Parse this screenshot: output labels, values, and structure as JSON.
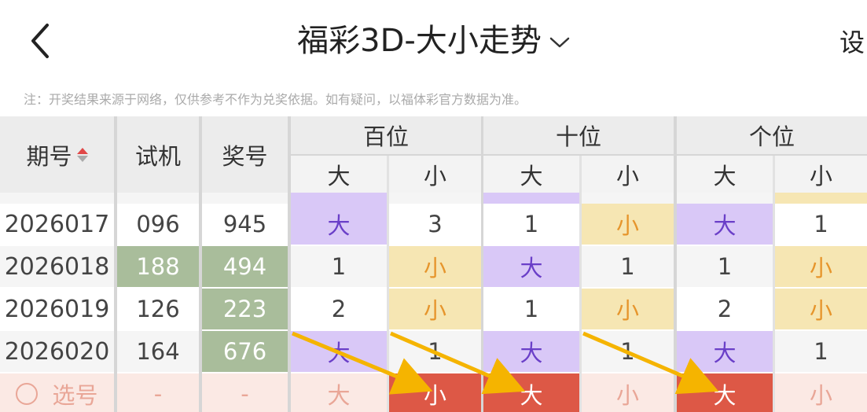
{
  "header": {
    "title": "福彩3D-大小走势",
    "settings_label": "设"
  },
  "notice": "注：开奖结果来源于网络，仅供参考不作为兑奖依据。如有疑问，以福体彩官方数据为准。",
  "table": {
    "col_period": "期号",
    "col_trial": "试机",
    "col_award": "奖号",
    "groups": [
      "百位",
      "十位",
      "个位"
    ],
    "sub_big": "大",
    "sub_small": "小",
    "rows": [
      {
        "period": "2026017",
        "trial": "096",
        "award": "945",
        "cells": [
          "大",
          "3",
          "1",
          "小",
          "大",
          "1"
        ]
      },
      {
        "period": "2026018",
        "trial": "188",
        "award": "494",
        "cells": [
          "1",
          "小",
          "大",
          "1",
          "1",
          "小"
        ]
      },
      {
        "period": "2026019",
        "trial": "126",
        "award": "223",
        "cells": [
          "2",
          "小",
          "1",
          "小",
          "2",
          "小"
        ]
      },
      {
        "period": "2026020",
        "trial": "164",
        "award": "676",
        "cells": [
          "大",
          "1",
          "大",
          "1",
          "大",
          "1"
        ]
      }
    ],
    "select_row": {
      "label": "选号",
      "trial": "-",
      "award": "-",
      "cells": [
        "大",
        "小",
        "大",
        "小",
        "大",
        "小"
      ]
    }
  },
  "colors": {
    "big_bg": "#d9c8f7",
    "small_bg": "#f6e6b3",
    "hit_green": "#a9bd9b",
    "selected_red": "#dd5846",
    "arrow": "#f5b400"
  }
}
